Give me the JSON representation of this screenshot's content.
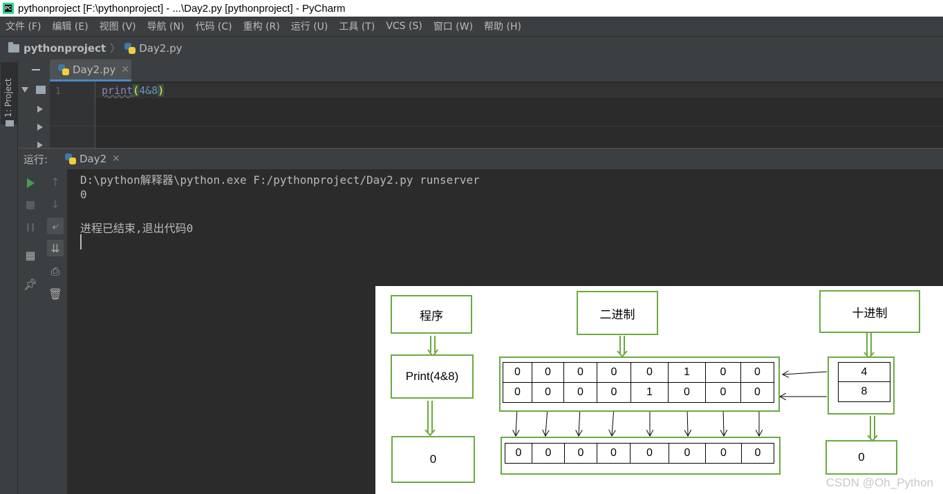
{
  "window": {
    "title": "pythonproject [F:\\pythonproject] - ...\\Day2.py [pythonproject] - PyCharm",
    "icon": "pycharm-icon"
  },
  "menu": [
    "文件 (F)",
    "编辑 (E)",
    "视图 (V)",
    "导航 (N)",
    "代码 (C)",
    "重构 (R)",
    "运行 (U)",
    "工具 (T)",
    "VCS (S)",
    "窗口 (W)",
    "帮助 (H)"
  ],
  "breadcrumb": {
    "project": "pythonproject",
    "file": "Day2.py"
  },
  "left_stripe": {
    "project_tab": "1: Project"
  },
  "editor": {
    "tab_label": "Day2.py",
    "line_number": "1",
    "code_fn": "print",
    "code_open": "(",
    "code_args": "4&8",
    "code_close": ")"
  },
  "run": {
    "label": "运行:",
    "tab_label": "Day2",
    "output": [
      "D:\\python解释器\\python.exe F:/pythonproject/Day2.py runserver",
      "0",
      "",
      "进程已结束,退出代码0"
    ]
  },
  "diagram": {
    "program_title": "程序",
    "binary_title": "二进制",
    "decimal_title": "十进制",
    "program_expr": "Print(4&8)",
    "program_result": "0",
    "binary_row1": [
      "0",
      "0",
      "0",
      "0",
      "0",
      "1",
      "0",
      "0"
    ],
    "binary_row2": [
      "0",
      "0",
      "0",
      "0",
      "1",
      "0",
      "0",
      "0"
    ],
    "binary_result": [
      "0",
      "0",
      "0",
      "0",
      "0",
      "0",
      "0",
      "0"
    ],
    "decimal_values": [
      "4",
      "8"
    ],
    "decimal_result": "0",
    "border_color": "#6aaa3e"
  },
  "watermark": "CSDN @Oh_Python"
}
